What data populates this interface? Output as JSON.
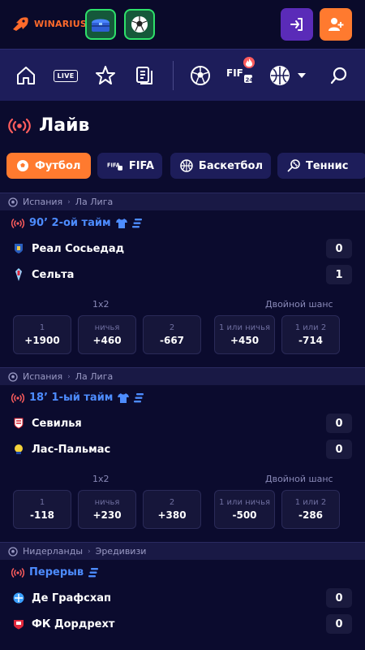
{
  "header": {
    "logo_text": "WINARIUS",
    "login_icon": "login-icon",
    "register_icon": "add-user-icon"
  },
  "nav": {
    "live_label": "LIVE",
    "fifa_label": "FIFA",
    "fifa_sub": "24"
  },
  "page": {
    "title": "Лайв"
  },
  "sports_tabs": [
    {
      "label": "Футбол",
      "icon": "soccer-ball-icon",
      "active": true
    },
    {
      "label": "FIFA",
      "icon": "fifa-icon",
      "active": false
    },
    {
      "label": "Баскетбол",
      "icon": "basketball-icon",
      "active": false
    },
    {
      "label": "Теннис",
      "icon": "tennis-icon",
      "active": false
    }
  ],
  "matches": [
    {
      "country": "Испания",
      "league": "Ла Лига",
      "status": "90’ 2-ой тайм",
      "home": {
        "name": "Реал Сосьедад",
        "score": "0"
      },
      "away": {
        "name": "Сельта",
        "score": "1"
      },
      "market1_title": "1х2",
      "market2_title": "Двойной шанс",
      "odds": [
        {
          "label": "1",
          "value": "+1900"
        },
        {
          "label": "ничья",
          "value": "+460"
        },
        {
          "label": "2",
          "value": "-667"
        },
        {
          "label": "1 или ничья",
          "value": "+450"
        },
        {
          "label": "1 или 2",
          "value": "-714"
        }
      ]
    },
    {
      "country": "Испания",
      "league": "Ла Лига",
      "status": "18’ 1-ый тайм",
      "home": {
        "name": "Севилья",
        "score": "0"
      },
      "away": {
        "name": "Лас-Пальмас",
        "score": "0"
      },
      "market1_title": "1х2",
      "market2_title": "Двойной шанс",
      "odds": [
        {
          "label": "1",
          "value": "-118"
        },
        {
          "label": "ничья",
          "value": "+230"
        },
        {
          "label": "2",
          "value": "+380"
        },
        {
          "label": "1 или ничья",
          "value": "-500"
        },
        {
          "label": "1 или 2",
          "value": "-286"
        }
      ]
    },
    {
      "country": "Нидерланды",
      "league": "Эредивизи",
      "status": "Перерыв",
      "home": {
        "name": "Де Графсхап",
        "score": "0"
      },
      "away": {
        "name": "ФК Дордрехт",
        "score": "0"
      }
    }
  ],
  "colors": {
    "accent": "#ff7a2f",
    "live_blue": "#4d8cff",
    "live_red": "#ff5d5d",
    "bg": "#0b0b2e",
    "nav_bg": "#1d1d5a"
  }
}
